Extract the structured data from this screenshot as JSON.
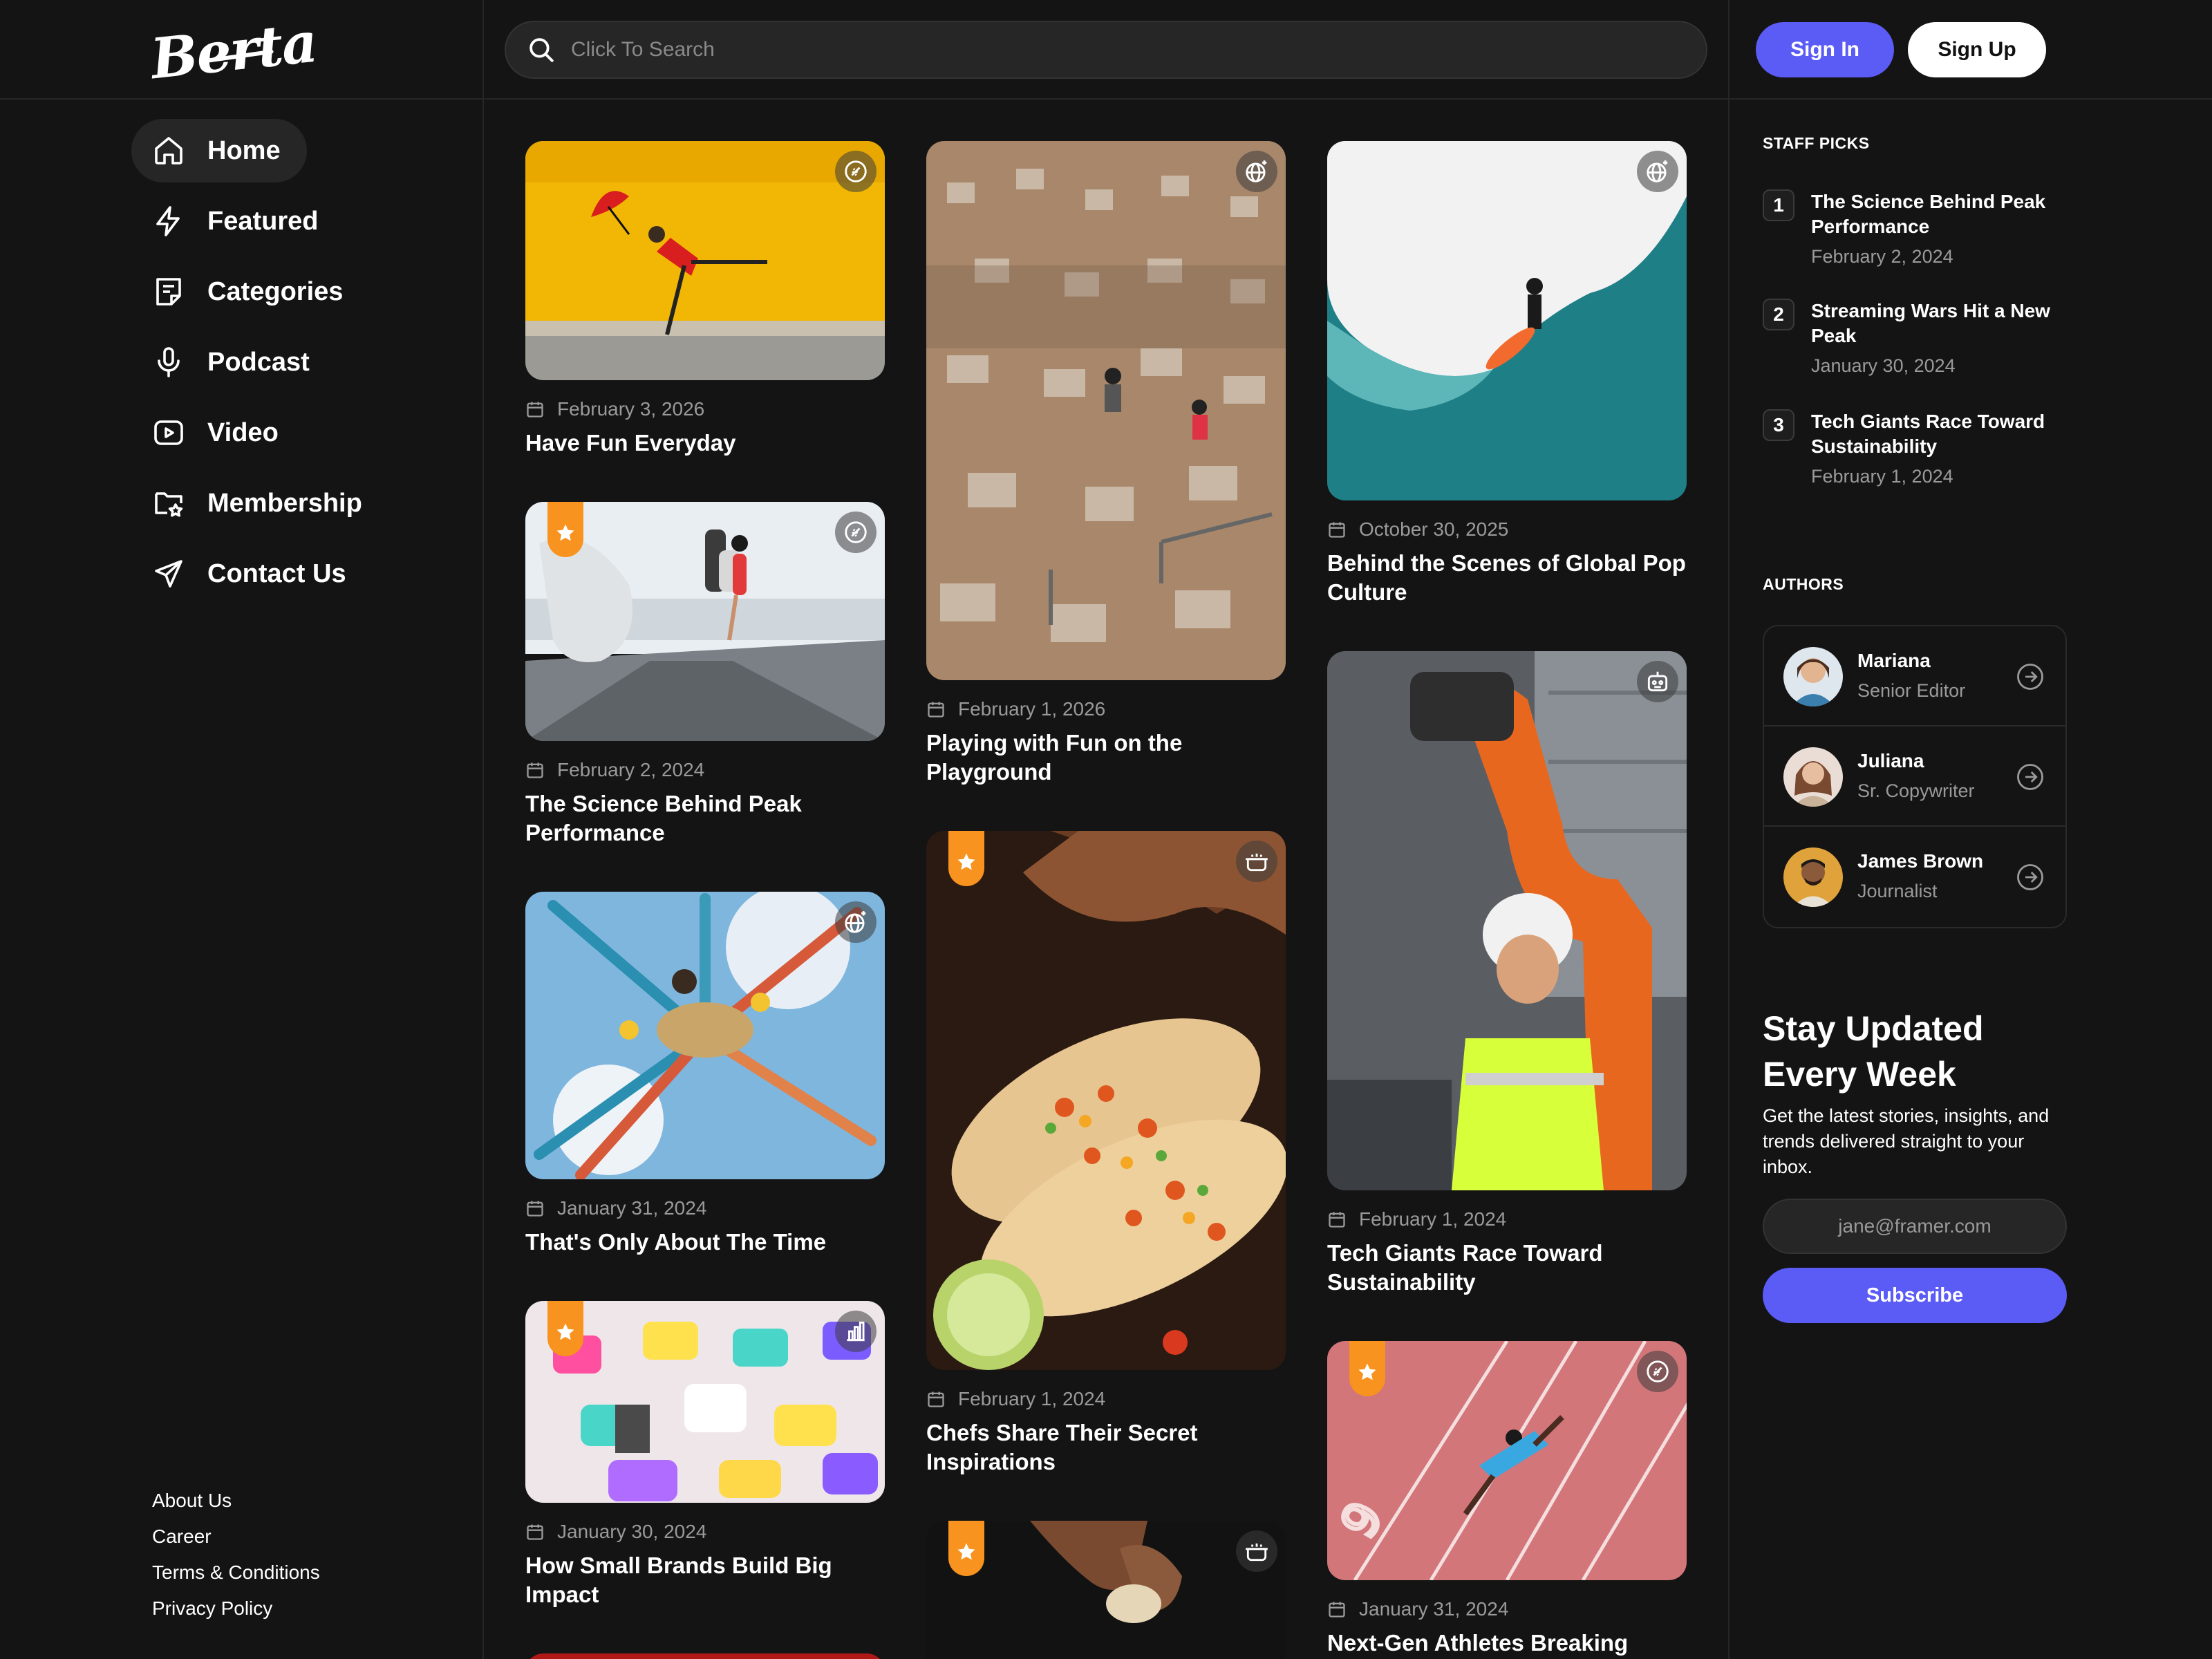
{
  "header": {
    "logo_text": "Berta",
    "search_placeholder": "Click To Search",
    "signin_label": "Sign In",
    "signup_label": "Sign Up"
  },
  "nav": {
    "items": [
      {
        "label": "Home",
        "icon": "home-icon"
      },
      {
        "label": "Featured",
        "icon": "lightning-icon"
      },
      {
        "label": "Categories",
        "icon": "document-list-icon"
      },
      {
        "label": "Podcast",
        "icon": "microphone-icon"
      },
      {
        "label": "Video",
        "icon": "video-play-icon"
      },
      {
        "label": "Membership",
        "icon": "folder-star-icon"
      },
      {
        "label": "Contact Us",
        "icon": "paper-plane-icon"
      }
    ],
    "active": "Home"
  },
  "footer_links": [
    "About Us",
    "Career",
    "Terms & Conditions",
    "Privacy Policy"
  ],
  "cards": [
    {
      "date": "February 3, 2026",
      "title": "Have Fun Everyday",
      "category_icon": "football-icon",
      "featured": false
    },
    {
      "date": "February 2, 2024",
      "title": "The Science Behind Peak Performance",
      "category_icon": "football-icon",
      "featured": true
    },
    {
      "date": "January 31, 2024",
      "title": "That's Only About The Time",
      "category_icon": "globe-sparkle-icon",
      "featured": false
    },
    {
      "date": "January 30, 2024",
      "title": "How Small Brands Build Big Impact",
      "category_icon": "bar-chart-icon",
      "featured": true
    },
    {
      "date": "February 1, 2026",
      "title": "Playing with Fun on the Playground",
      "category_icon": "globe-sparkle-icon",
      "featured": false
    },
    {
      "date": "February 1, 2024",
      "title": "Chefs Share Their Secret Inspirations",
      "category_icon": "cooking-pot-icon",
      "featured": true
    },
    {
      "date": "",
      "title": "",
      "category_icon": "cooking-pot-icon",
      "featured": true
    },
    {
      "date": "October 30, 2025",
      "title": "Behind the Scenes of Global Pop Culture",
      "category_icon": "globe-sparkle-icon",
      "featured": false
    },
    {
      "date": "February 1, 2024",
      "title": "Tech Giants Race Toward Sustainability",
      "category_icon": "robot-icon",
      "featured": false
    },
    {
      "date": "January 31, 2024",
      "title": "Next-Gen Athletes Breaking",
      "category_icon": "football-icon",
      "featured": true
    }
  ],
  "staff_picks": {
    "label": "STAFF PICKS",
    "items": [
      {
        "num": "1",
        "title": "The Science Behind Peak Performance",
        "date": "February 2, 2024"
      },
      {
        "num": "2",
        "title": "Streaming Wars Hit a New Peak",
        "date": "January 30, 2024"
      },
      {
        "num": "3",
        "title": "Tech Giants Race Toward Sustainability",
        "date": "February 1, 2024"
      }
    ]
  },
  "authors": {
    "label": "AUTHORS",
    "items": [
      {
        "name": "Mariana",
        "role": "Senior Editor"
      },
      {
        "name": "Juliana",
        "role": "Sr. Copywriter"
      },
      {
        "name": "James Brown",
        "role": "Journalist"
      }
    ]
  },
  "newsletter": {
    "title": "Stay Updated Every Week",
    "description": "Get the latest stories, insights, and trends delivered straight to your inbox.",
    "email_placeholder": "jane@framer.com",
    "subscribe_label": "Subscribe"
  },
  "colors": {
    "background": "#141414",
    "accent": "#5b5bf6",
    "ribbon": "#f7931e",
    "muted_text": "#9a9a9a"
  }
}
